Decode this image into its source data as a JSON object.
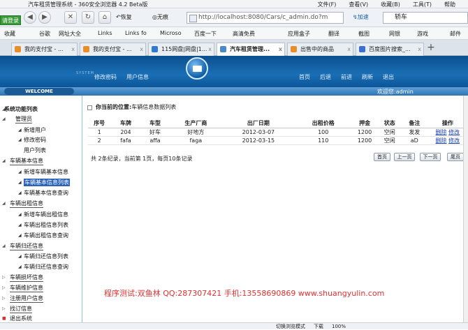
{
  "window": {
    "title": "汽车租赁管理系统 - 360安全浏览器 4.2 Beta版",
    "menus": [
      "文件(F)",
      "查看(V)",
      "收藏(B)",
      "工具(T)",
      "帮助"
    ]
  },
  "login_badge": "请登录",
  "nav": {
    "address": "http://localhost:8080/Cars/c_admin.do?m",
    "restore": "恢复",
    "cache_label": "无痕",
    "accel": "加速",
    "search_value": "轿车"
  },
  "favorites": [
    "收藏",
    "谷歌",
    "网址大全",
    "Links",
    "Links fo",
    "Microso",
    "百度一下",
    "高清免费",
    "应用盒子",
    "翻译",
    "截图",
    "网银",
    "游戏",
    "邮件"
  ],
  "tabs": [
    {
      "label": "我的支付宝 - ...",
      "active": false,
      "color": "#e98d2b"
    },
    {
      "label": "我的支付宝 - ...",
      "active": false,
      "color": "#e98d2b"
    },
    {
      "label": "115网盘|网盘|1...",
      "active": false,
      "color": "#2e7ad1"
    },
    {
      "label": "汽车租赁管理...",
      "active": true,
      "color": "#4b8ac9"
    },
    {
      "label": "出售中的商品",
      "active": false,
      "color": "#e98d2b"
    },
    {
      "label": "百度图片搜索_...",
      "active": false,
      "color": "#3b6fd1"
    }
  ],
  "header": {
    "system_label": "SYSTEM",
    "left_links": [
      "修改密码",
      "用户信息"
    ],
    "right_links": [
      "首页",
      "后退",
      "前进",
      "刷新",
      "退出"
    ]
  },
  "welcome": {
    "tag": "WELCOME",
    "user_text": "欢迎您:admin"
  },
  "sidebar": {
    "title": "系统功能列表",
    "groups": [
      {
        "label": "管理员",
        "items": [
          "新增用户",
          "修改密码",
          "用户列表"
        ]
      },
      {
        "label": "车辆基本信息",
        "items": [
          "新增车辆基本信息",
          "车辆基本信息列表",
          "车辆基本信息查询"
        ]
      },
      {
        "label": "车辆出租信息",
        "items": [
          "新增车辆出租信息",
          "车辆出租信息列表",
          "车辆出租信息查询"
        ]
      },
      {
        "label": "车辆归还信息",
        "items": [
          "车辆归还信息列表",
          "车辆归还信息查询"
        ]
      },
      {
        "label": "车辆损坏信息",
        "items": []
      },
      {
        "label": "车辆维护信息",
        "items": []
      },
      {
        "label": "注册用户信息",
        "items": []
      },
      {
        "label": "找订信息",
        "items": []
      },
      {
        "label": "退出系统",
        "items": []
      }
    ]
  },
  "main": {
    "location_prefix": "你当前的位置:",
    "location": "车辆信息数据列表",
    "table": {
      "headers": [
        "序号",
        "车牌",
        "车型",
        "生产厂商",
        "出厂日期",
        "出租价格",
        "押金",
        "状态",
        "备注",
        "操作"
      ],
      "rows": [
        {
          "no": "1",
          "plate": "204",
          "model": "好车",
          "maker": "好地方",
          "date": "2012-03-07",
          "price": "100",
          "deposit": "1200",
          "status": "空闲",
          "remark": "发发",
          "op_delete": "删除",
          "op_edit": "修改"
        },
        {
          "no": "2",
          "plate": "fafa",
          "model": "affa",
          "maker": "faga",
          "date": "2012-03-15",
          "price": "110",
          "deposit": "1200",
          "status": "空闲",
          "remark": "aD",
          "op_delete": "删除",
          "op_edit": "修改"
        }
      ]
    },
    "pagination": {
      "info": "共 2条纪录，当前第 1页，每页10条记录",
      "first": "首页",
      "prev": "上一页",
      "next": "下一页",
      "last": "尾页"
    },
    "watermark": "程序测试:双鱼林 QQ:287307421 手机:13558690869 www.shuangyulin.com"
  },
  "statusbar": {
    "mode": "切换浏览模式",
    "download": "下载",
    "zoom": "100%"
  }
}
